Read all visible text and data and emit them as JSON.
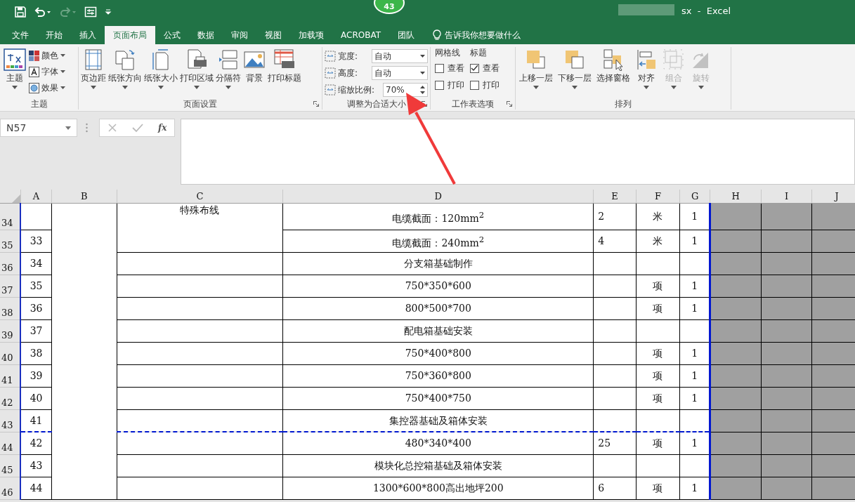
{
  "title_bar": {
    "title": "sx  -  Excel",
    "badge": "43",
    "quick_access": [
      {
        "kind": "save",
        "disabled": false
      },
      {
        "kind": "undo",
        "disabled": false
      },
      {
        "kind": "redo",
        "disabled": true
      },
      {
        "kind": "form",
        "disabled": false
      },
      {
        "kind": "customize",
        "disabled": false
      }
    ]
  },
  "tabs": [
    {
      "label": "文件",
      "selected": false
    },
    {
      "label": "开始",
      "selected": false
    },
    {
      "label": "插入",
      "selected": false
    },
    {
      "label": "页面布局",
      "selected": true
    },
    {
      "label": "公式",
      "selected": false
    },
    {
      "label": "数据",
      "selected": false
    },
    {
      "label": "审阅",
      "selected": false
    },
    {
      "label": "视图",
      "selected": false
    },
    {
      "label": "加载项",
      "selected": false
    },
    {
      "label": "ACROBAT",
      "selected": false
    },
    {
      "label": "团队",
      "selected": false
    }
  ],
  "tell_me": "告诉我你想要做什么",
  "theme_group": {
    "label": "主题",
    "main": "主题",
    "items": [
      {
        "label": "颜色",
        "kind": "colors"
      },
      {
        "label": "字体",
        "kind": "fonts"
      },
      {
        "label": "效果",
        "kind": "effects"
      }
    ]
  },
  "page_setup_group": {
    "label": "页面设置",
    "buttons": [
      {
        "label": "页边距",
        "kind": "margins",
        "dropdown": true
      },
      {
        "label": "纸张方向",
        "kind": "orientation",
        "dropdown": true
      },
      {
        "label": "纸张大小",
        "kind": "size",
        "dropdown": true
      },
      {
        "label": "打印区域",
        "kind": "printarea",
        "dropdown": true
      },
      {
        "label": "分隔符",
        "kind": "breaks",
        "dropdown": true
      },
      {
        "label": "背景",
        "kind": "background",
        "dropdown": false
      },
      {
        "label": "打印标题",
        "kind": "titles",
        "dropdown": false
      }
    ]
  },
  "scale_group": {
    "label": "调整为合适大小",
    "fields": [
      {
        "label": "宽度:",
        "value": "自动",
        "kind": "dropdown"
      },
      {
        "label": "高度:",
        "value": "自动",
        "kind": "dropdown"
      },
      {
        "label": "缩放比例:",
        "value": "70%",
        "kind": "spinner"
      }
    ]
  },
  "sheet_options_group": {
    "label": "工作表选项",
    "columns": [
      {
        "title": "网格线",
        "options": [
          {
            "label": "查看",
            "checked": false
          },
          {
            "label": "打印",
            "checked": false
          }
        ]
      },
      {
        "title": "标题",
        "options": [
          {
            "label": "查看",
            "checked": true
          },
          {
            "label": "打印",
            "checked": false
          }
        ]
      }
    ]
  },
  "arrange_group": {
    "label": "排列",
    "buttons": [
      {
        "label": "上移一层",
        "kind": "forward",
        "dropdown": true,
        "disabled": false
      },
      {
        "label": "下移一层",
        "kind": "backward",
        "dropdown": true,
        "disabled": false
      },
      {
        "label": "选择窗格",
        "kind": "pane",
        "dropdown": false,
        "disabled": false
      },
      {
        "label": "对齐",
        "kind": "align",
        "dropdown": true,
        "disabled": false
      },
      {
        "label": "组合",
        "kind": "group",
        "dropdown": true,
        "disabled": true
      },
      {
        "label": "旋转",
        "kind": "rotate",
        "dropdown": true,
        "disabled": true
      }
    ]
  },
  "name_box": "N57",
  "formula_label": "fx",
  "columns": [
    {
      "label": "A",
      "print_area": true
    },
    {
      "label": "B",
      "print_area": true
    },
    {
      "label": "C",
      "print_area": true
    },
    {
      "label": "D",
      "print_area": true
    },
    {
      "label": "E",
      "print_area": true
    },
    {
      "label": "F",
      "print_area": true
    },
    {
      "label": "G",
      "print_area": true
    },
    {
      "label": "H",
      "print_area": false
    },
    {
      "label": "I",
      "print_area": false
    },
    {
      "label": "J",
      "print_area": false
    }
  ],
  "merged_c": "特殊布线",
  "rows": [
    {
      "header": "34",
      "a": "",
      "d": "电缆截面：120mm$^{2}$",
      "e": "2",
      "f": "米",
      "g": "1",
      "page_break_after": false
    },
    {
      "header": "35",
      "a": "33",
      "d": "电缆截面：240mm$^{2}$",
      "e": "4",
      "f": "米",
      "g": "1",
      "page_break_after": false
    },
    {
      "header": "36",
      "a": "34",
      "d": "分支箱基础制作",
      "e": "",
      "f": "",
      "g": "",
      "page_break_after": false
    },
    {
      "header": "37",
      "a": "35",
      "d": "750*350*600",
      "e": "",
      "f": "项",
      "g": "1",
      "page_break_after": false
    },
    {
      "header": "38",
      "a": "36",
      "d": "800*500*700",
      "e": "",
      "f": "项",
      "g": "1",
      "page_break_after": false
    },
    {
      "header": "39",
      "a": "37",
      "d": "配电箱基础安装",
      "e": "",
      "f": "",
      "g": "",
      "page_break_after": false
    },
    {
      "header": "40",
      "a": "38",
      "d": "750*400*800",
      "e": "",
      "f": "项",
      "g": "1",
      "page_break_after": false
    },
    {
      "header": "41",
      "a": "39",
      "d": "750*360*800",
      "e": "",
      "f": "项",
      "g": "1",
      "page_break_after": false
    },
    {
      "header": "42",
      "a": "40",
      "d": "750*400*750",
      "e": "",
      "f": "项",
      "g": "1",
      "page_break_after": false
    },
    {
      "header": "43",
      "a": "41",
      "d": "集控器基础及箱体安装",
      "e": "",
      "f": "",
      "g": "",
      "page_break_after": true
    },
    {
      "header": "44",
      "a": "42",
      "d": "480*340*400",
      "e": "25",
      "f": "项",
      "g": "1",
      "page_break_after": false
    },
    {
      "header": "45",
      "a": "43",
      "d": "模块化总控箱基础及箱体安装",
      "e": "",
      "f": "",
      "g": "",
      "page_break_after": false
    },
    {
      "header": "46",
      "a": "44",
      "d": "1300*600*800高出地坪200",
      "e": "6",
      "f": "项",
      "g": "1",
      "page_break_after": false
    }
  ]
}
